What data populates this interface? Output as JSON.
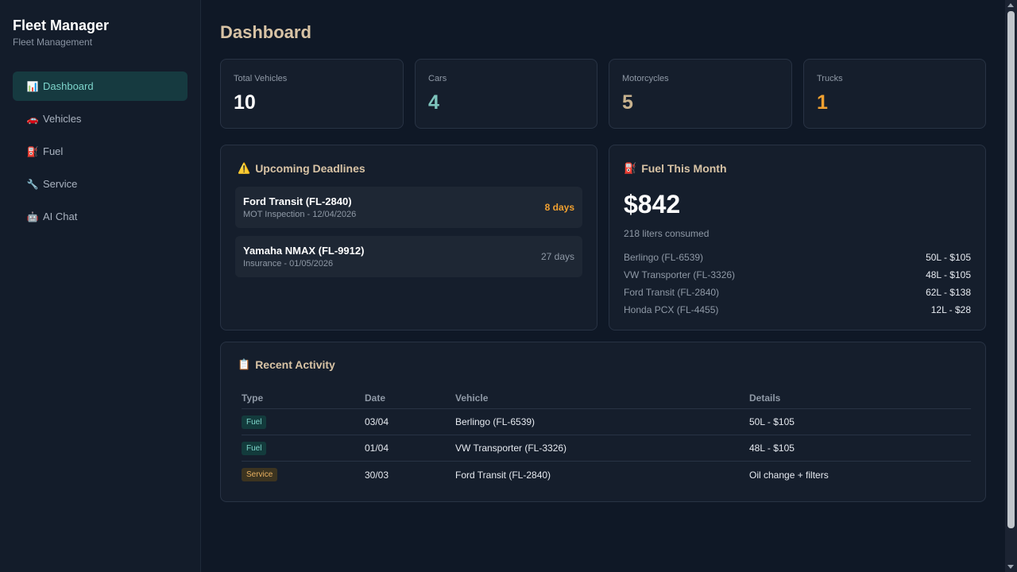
{
  "sidebar": {
    "title": "Fleet Manager",
    "subtitle": "Fleet Management",
    "items": [
      {
        "label": "Dashboard",
        "icon": "📊",
        "icon_name": "chart-icon",
        "active": true
      },
      {
        "label": "Vehicles",
        "icon": "🚗",
        "icon_name": "car-icon",
        "active": false
      },
      {
        "label": "Fuel",
        "icon": "⛽",
        "icon_name": "fuel-pump-icon",
        "active": false
      },
      {
        "label": "Service",
        "icon": "🔧",
        "icon_name": "wrench-icon",
        "active": false
      },
      {
        "label": "AI Chat",
        "icon": "🤖",
        "icon_name": "robot-icon",
        "active": false
      }
    ]
  },
  "main": {
    "title": "Dashboard",
    "stats": [
      {
        "label": "Total Vehicles",
        "value": "10",
        "color": "#ffffff"
      },
      {
        "label": "Cars",
        "value": "4",
        "color": "#7ec4bd"
      },
      {
        "label": "Motorcycles",
        "value": "5",
        "color": "#c8b28e"
      },
      {
        "label": "Trucks",
        "value": "1",
        "color": "#f0a030"
      }
    ],
    "deadlines": {
      "title": "Upcoming Deadlines",
      "icon": "⚠️",
      "items": [
        {
          "name": "Ford Transit (FL-2840)",
          "detail": "MOT Inspection - 12/04/2026",
          "days": "8 days",
          "color": "#f0a030"
        },
        {
          "name": "Yamaha NMAX (FL-9912)",
          "detail": "Insurance - 01/05/2026",
          "days": "27 days",
          "color": "#8f99a6"
        }
      ]
    },
    "fuel": {
      "title": "Fuel This Month",
      "icon": "⛽",
      "total": "$842",
      "liters": "218 liters consumed",
      "rows": [
        {
          "vehicle": "Berlingo (FL-6539)",
          "detail": "50L - $105"
        },
        {
          "vehicle": "VW Transporter (FL-3326)",
          "detail": "48L - $105"
        },
        {
          "vehicle": "Ford Transit (FL-2840)",
          "detail": "62L - $138"
        },
        {
          "vehicle": "Honda PCX (FL-4455)",
          "detail": "12L - $28"
        }
      ]
    },
    "activity": {
      "title": "Recent Activity",
      "icon": "📋",
      "columns": [
        "Type",
        "Date",
        "Vehicle",
        "Details"
      ],
      "rows": [
        {
          "type": "Fuel",
          "kind": "fuel",
          "date": "03/04",
          "vehicle": "Berlingo (FL-6539)",
          "details": "50L - $105"
        },
        {
          "type": "Fuel",
          "kind": "fuel",
          "date": "01/04",
          "vehicle": "VW Transporter (FL-3326)",
          "details": "48L - $105"
        },
        {
          "type": "Service",
          "kind": "service",
          "date": "30/03",
          "vehicle": "Ford Transit (FL-2840)",
          "details": "Oil change + filters"
        }
      ]
    }
  }
}
